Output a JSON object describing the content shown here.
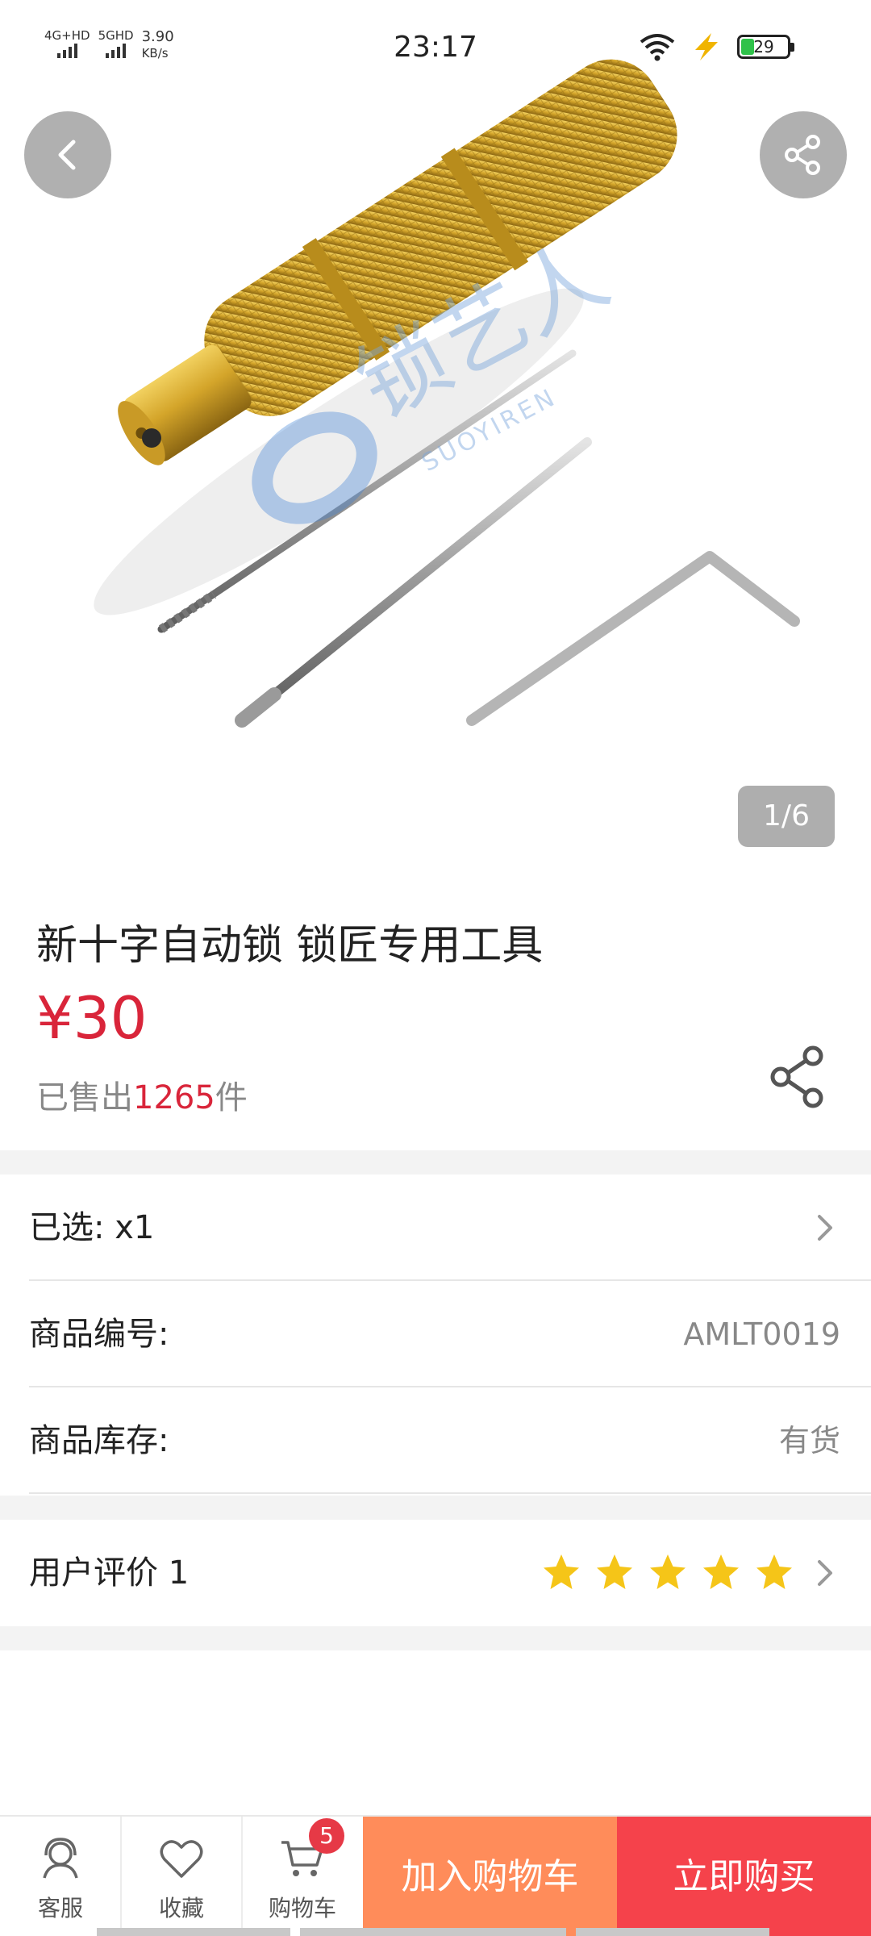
{
  "status_bar": {
    "network_1": "4G+HD",
    "network_2": "5GHD",
    "speed_value": "3.90",
    "speed_unit": "KB/s",
    "time": "23:17",
    "battery_level": "29"
  },
  "gallery": {
    "counter": "1/6",
    "watermark_brand": "锁艺人",
    "watermark_sub": "SUOYIREN"
  },
  "product": {
    "title": "新十字自动锁 锁匠专用工具",
    "price": "¥30",
    "sold_prefix": "已售出",
    "sold_count": "1265",
    "sold_suffix": "件"
  },
  "specs": {
    "selected_label": "已选: x1",
    "code_label": "商品编号:",
    "code_value": "AMLT0019",
    "stock_label": "商品库存:",
    "stock_value": "有货"
  },
  "reviews": {
    "label": "用户评价 1",
    "rating": 5,
    "rating_max": 5
  },
  "bottom_bar": {
    "service_label": "客服",
    "favorite_label": "收藏",
    "cart_label": "购物车",
    "cart_badge": "5",
    "add_to_cart": "加入购物车",
    "buy_now": "立即购买"
  },
  "colors": {
    "price_red": "#d9253a",
    "star_yellow": "#f5c518",
    "add_cart_orange": "#ff8c5a",
    "buy_red": "#f5424b"
  }
}
